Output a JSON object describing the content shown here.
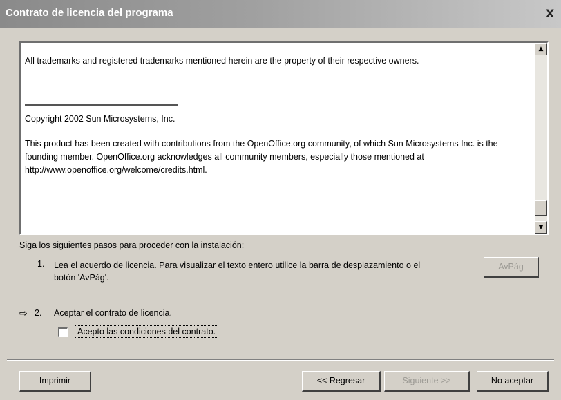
{
  "window": {
    "title": "Contrato de licencia del programa",
    "close_label": "X"
  },
  "license": {
    "trademarks": "All trademarks and registered trademarks mentioned herein are the property of their respective owners.",
    "copyright": "Copyright 2002 Sun Microsystems, Inc.",
    "product": "This product has been created with contributions from the OpenOffice.org community, of which Sun Microsystems Inc. is the founding member. OpenOffice.org acknowledges all community members, especially those mentioned at http://www.openoffice.org/welcome/credits.html."
  },
  "steps": {
    "heading": "Siga los siguientes pasos para proceder con la instalación:",
    "step1_number": "1.",
    "step1_text": "Lea el acuerdo de licencia. Para visualizar el texto entero utilice la barra de desplazamiento o el botón 'AvPág'.",
    "avpag_label": "AvPág",
    "arrow_icon": "⇨",
    "step2_number": "2.",
    "step2_text": "Aceptar el contrato de licencia.",
    "accept_checkbox_label": "Acepto las condiciones del contrato."
  },
  "buttons": {
    "print": "Imprimir",
    "back": "<< Regresar",
    "next": "Siguiente >>",
    "decline": "No aceptar"
  },
  "scroll_icons": {
    "up": "▲",
    "down": "▼"
  }
}
